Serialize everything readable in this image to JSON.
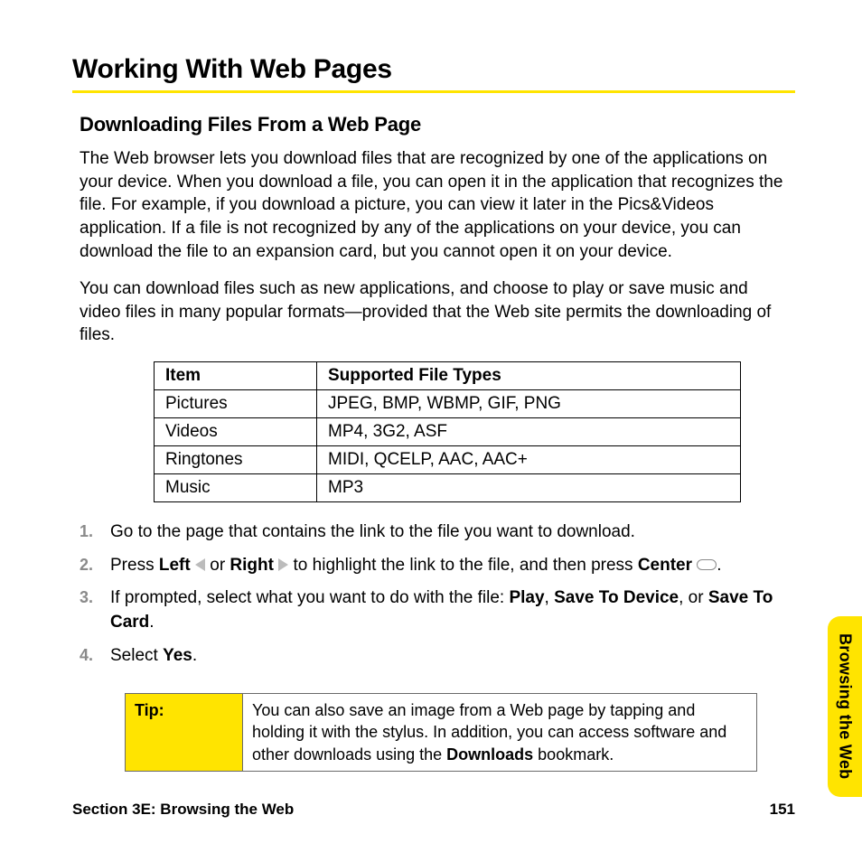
{
  "title": "Working With Web Pages",
  "subheading": "Downloading Files From a Web Page",
  "para1": "The Web browser lets you download files that are recognized by one of the applications on your device. When you download a file, you can open it in the application that recognizes the file. For example, if you download a picture, you can view it later in the Pics&Videos application. If a file is not recognized by any of the applications on your device, you can download the file to an expansion card, but you cannot open it on your device.",
  "para2": "You can download files such as new applications, and choose to play or save music and video files in many popular formats—provided that the Web site permits the downloading of files.",
  "table": {
    "head": {
      "c1": "Item",
      "c2": "Supported File Types"
    },
    "rows": [
      {
        "c1": "Pictures",
        "c2": "JPEG, BMP, WBMP, GIF, PNG"
      },
      {
        "c1": "Videos",
        "c2": "MP4, 3G2, ASF"
      },
      {
        "c1": "Ringtones",
        "c2": "MIDI, QCELP, AAC, AAC+"
      },
      {
        "c1": "Music",
        "c2": "MP3"
      }
    ]
  },
  "steps": {
    "s1": "Go to the page that contains the link to the file you want to download.",
    "s2a": "Press ",
    "s2_left": "Left",
    "s2b": " or ",
    "s2_right": "Right",
    "s2c": " to highlight the link to the file, and then press ",
    "s2_center": "Center",
    "s2d": ".",
    "s3a": "If prompted, select what you want to do with the file: ",
    "s3_play": "Play",
    "s3_comma1": ", ",
    "s3_save_dev": "Save To Device",
    "s3_comma2": ", or ",
    "s3_save_card": "Save To Card",
    "s3_period": ".",
    "s4a": "Select ",
    "s4_yes": "Yes",
    "s4b": "."
  },
  "tip": {
    "label": "Tip:",
    "body_a": "You can also save an image from a Web page by tapping and holding it with the stylus. In addition, you can access software and other downloads using the ",
    "body_bold": "Downloads",
    "body_b": " bookmark."
  },
  "footer": {
    "section": "Section 3E: Browsing the Web",
    "page": "151"
  },
  "side_tab": "Browsing the Web"
}
